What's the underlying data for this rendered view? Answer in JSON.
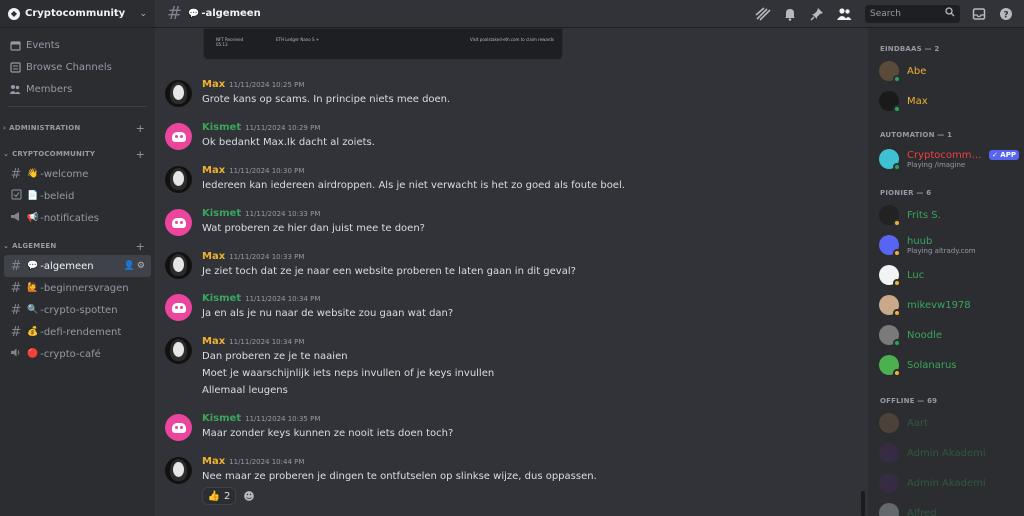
{
  "server": {
    "name": "Cryptocommunity"
  },
  "sidebar": {
    "top_items": [
      {
        "label": "Events",
        "icon": "calendar-icon"
      },
      {
        "label": "Browse Channels",
        "icon": "browse-icon"
      },
      {
        "label": "Members",
        "icon": "members-icon"
      }
    ],
    "categories": [
      {
        "name": "ADMINISTRATION",
        "channels": []
      },
      {
        "name": "CRYPTOCOMMUNITY",
        "channels": [
          {
            "emoji": "👋",
            "name": "-welcome",
            "type": "text"
          },
          {
            "emoji": "📄",
            "name": "-beleid",
            "type": "rules"
          },
          {
            "emoji": "📢",
            "name": "-notificaties",
            "type": "announcement"
          }
        ]
      },
      {
        "name": "ALGEMEEN",
        "channels": [
          {
            "emoji": "💬",
            "name": "-algemeen",
            "type": "text",
            "active": true
          },
          {
            "emoji": "🙋",
            "name": "-beginnersvragen",
            "type": "text"
          },
          {
            "emoji": "🔍",
            "name": "-crypto-spotten",
            "type": "text"
          },
          {
            "emoji": "💰",
            "name": "-defi-rendement",
            "type": "text"
          },
          {
            "emoji": "🔴",
            "name": "-crypto-café",
            "type": "voice"
          }
        ]
      }
    ]
  },
  "header": {
    "channel_emoji": "💬",
    "channel_name": "-algemeen",
    "search_placeholder": "Search"
  },
  "embed": {
    "left_title": "NFT Received",
    "left_sub": "05:13",
    "mid": "ETH Ledger Nano S +",
    "right": "Visit poolstaked-eth.com to claim rewards"
  },
  "messages": [
    {
      "user": "Max",
      "time": "11/11/2024 10:25 PM",
      "lines": [
        "Grote kans op scams. In principe niets mee doen."
      ]
    },
    {
      "user": "Kismet",
      "time": "11/11/2024 10:29 PM",
      "lines": [
        "Ok bedankt Max.Ik dacht al zoiets."
      ]
    },
    {
      "user": "Max",
      "time": "11/11/2024 10:30 PM",
      "lines": [
        "Iedereen kan iedereen airdroppen. Als je niet verwacht is het zo goed als foute boel."
      ]
    },
    {
      "user": "Kismet",
      "time": "11/11/2024 10:33 PM",
      "lines": [
        "Wat proberen ze hier dan juist mee te doen?"
      ]
    },
    {
      "user": "Max",
      "time": "11/11/2024 10:33 PM",
      "lines": [
        "Je ziet toch dat ze je naar een website proberen te laten gaan in dit geval?"
      ]
    },
    {
      "user": "Kismet",
      "time": "11/11/2024 10:34 PM",
      "lines": [
        "Ja en als je nu naar de website zou gaan wat dan?"
      ]
    },
    {
      "user": "Max",
      "time": "11/11/2024 10:34 PM",
      "lines": [
        "Dan proberen ze je te naaien",
        "Moet je waarschijnlijk iets neps invullen of je keys invullen",
        "Allemaal leugens"
      ]
    },
    {
      "user": "Kismet",
      "time": "11/11/2024 10:35 PM",
      "lines": [
        "Maar zonder keys kunnen ze nooit iets doen toch?"
      ]
    },
    {
      "user": "Max",
      "time": "11/11/2024 10:44 PM",
      "lines": [
        "Nee maar ze proberen je dingen te ontfutselen op slinkse wijze, dus oppassen."
      ],
      "reaction": {
        "emoji": "👍",
        "count": "2"
      }
    }
  ],
  "members": {
    "groups": [
      {
        "title": "EINDBAAS — 2",
        "items": [
          {
            "name": "Abe",
            "color": "#f0b132",
            "status": "on"
          },
          {
            "name": "Max",
            "color": "#f0b132",
            "status": "on"
          }
        ]
      },
      {
        "title": "AUTOMATION — 1",
        "items": [
          {
            "name": "Cryptocommu...",
            "color": "#f23f43",
            "status": "on",
            "badge": "✓ APP",
            "activity": "Playing /imagine"
          }
        ]
      },
      {
        "title": "PIONIER — 6",
        "items": [
          {
            "name": "Frits S.",
            "color": "#3ba55c",
            "status": "idle"
          },
          {
            "name": "huub",
            "color": "#3ba55c",
            "status": "idle",
            "activity": "Playing altrady.com"
          },
          {
            "name": "Luc",
            "color": "#3ba55c",
            "status": "idle"
          },
          {
            "name": "mikevw1978",
            "color": "#3ba55c",
            "status": "idle"
          },
          {
            "name": "Noodle",
            "color": "#3ba55c",
            "status": "on"
          },
          {
            "name": "Solanarus",
            "color": "#3ba55c",
            "status": "idle"
          }
        ]
      },
      {
        "title": "OFFLINE — 69",
        "items": [
          {
            "name": "Aart",
            "color": "#3ba55c",
            "status": "off"
          },
          {
            "name": "Admin Akademi",
            "color": "#3ba55c",
            "status": "off"
          },
          {
            "name": "Admin Akademi",
            "color": "#3ba55c",
            "status": "off"
          },
          {
            "name": "Alfred",
            "color": "#3ba55c",
            "status": "off"
          }
        ]
      }
    ]
  },
  "colors": {
    "max": "#f0b132",
    "kismet": "#3ba55c",
    "kismet_avatar": "#eb459e",
    "active_channel": "#404249"
  }
}
